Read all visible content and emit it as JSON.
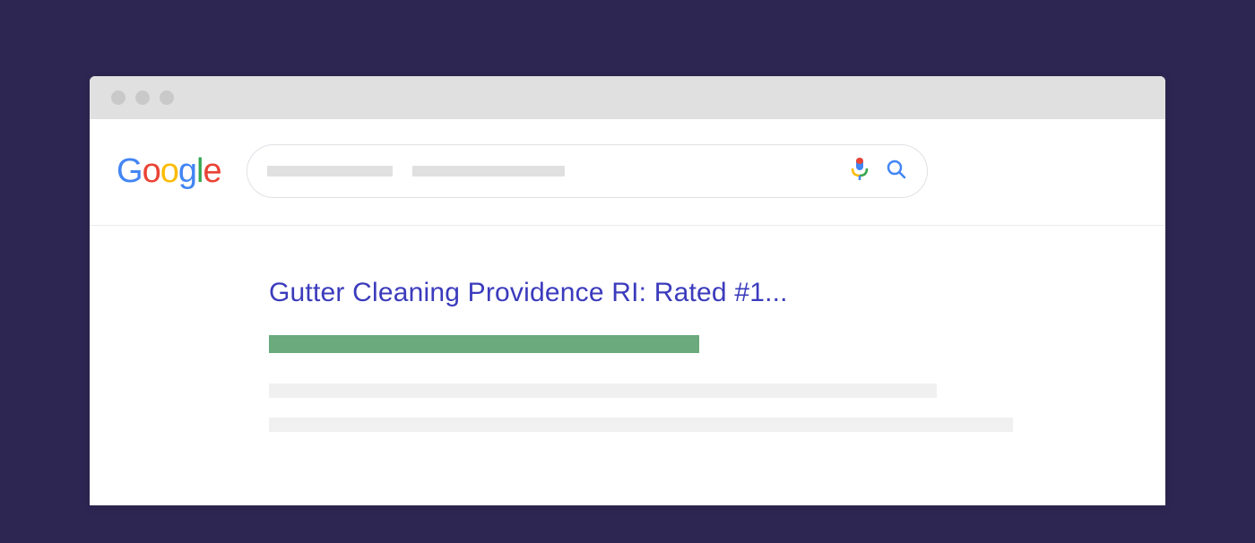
{
  "logo": {
    "g1": "G",
    "g2": "o",
    "g3": "o",
    "g4": "g",
    "g5": "l",
    "g6": "e"
  },
  "result": {
    "title": "Gutter Cleaning Providence RI: Rated #1..."
  }
}
